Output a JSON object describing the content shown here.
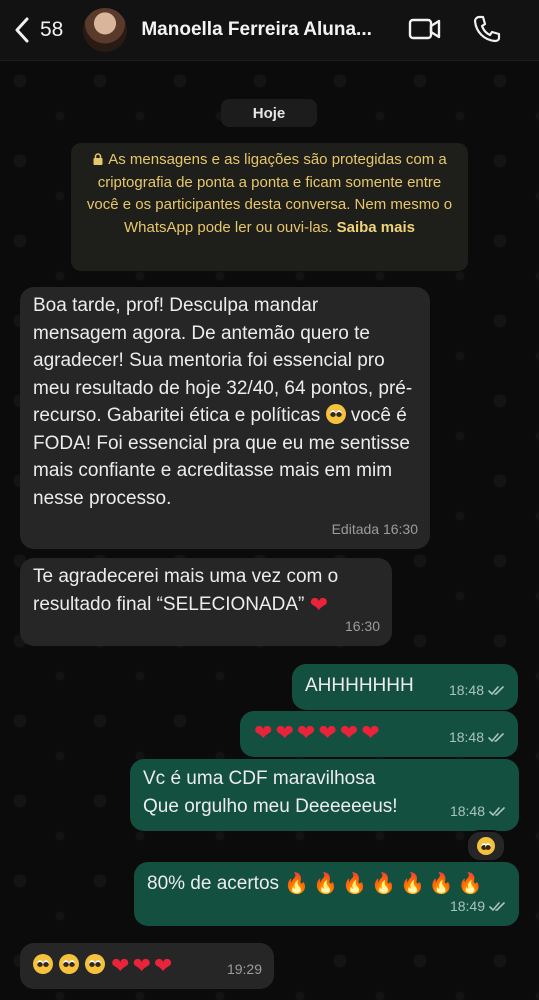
{
  "header": {
    "unread_count": "58",
    "contact_name": "Manoella Ferreira Aluna..."
  },
  "date_chip": "Hoje",
  "e2e_notice": {
    "text": "As mensagens e as ligações são protegidas com a criptografia de ponta a ponta e ficam somente entre você e os participantes desta conversa. Nem mesmo o WhatsApp pode ler ou ouvi-las.",
    "link": "Saiba mais"
  },
  "messages": [
    {
      "direction": "incoming",
      "text_part1": "Boa tarde, prof! Desculpa mandar mensagem agora. De antemão quero te agradecer! Sua mentoria foi essencial pro meu resultado de hoje 32/40, 64 pontos, pré-recurso. Gabaritei ética e políticas",
      "emoji": "pleading-face",
      "text_part2": "você é FODA! Foi essencial pra que eu me sentisse mais confiante e acreditasse mais em mim nesse processo.",
      "time": "Editada  16:30"
    },
    {
      "direction": "incoming",
      "text": "Te agradecerei mais uma vez com o resultado final “SELECIONADA”",
      "emoji": "red-heart",
      "time": "16:30"
    },
    {
      "direction": "outgoing",
      "text": "AHHHHHHH",
      "time": "18:48"
    },
    {
      "direction": "outgoing",
      "hearts": 6,
      "time": "18:48"
    },
    {
      "direction": "outgoing",
      "line1": "Vc é uma CDF maravilhosa",
      "line2": "Que orgulho meu Deeeeeeus!",
      "time": "18:48",
      "reaction": "pleading-face"
    },
    {
      "direction": "outgoing",
      "text": "80% de acertos",
      "fires": 7,
      "time": "18:49"
    },
    {
      "direction": "incoming",
      "faces": 3,
      "hearts": 3,
      "time": "19:29"
    }
  ],
  "colors": {
    "incoming_bubble": "#262626",
    "outgoing_bubble": "#13503f",
    "notice_text": "#e8c76a"
  }
}
